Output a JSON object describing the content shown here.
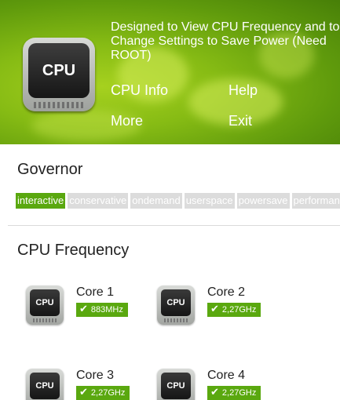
{
  "header": {
    "app_icon_text": "CPU",
    "description": "Designed to View CPU Frequency and to Change Settings to Save Power (Need ROOT)",
    "menu": {
      "cpu_info": "CPU Info",
      "help": "Help",
      "more": "More",
      "exit": "Exit"
    }
  },
  "governor": {
    "title": "Governor",
    "options": [
      "interactive",
      "conservative",
      "ondemand",
      "userspace",
      "powersave",
      "performance"
    ],
    "selected": "interactive"
  },
  "frequency": {
    "title": "CPU Frequency",
    "cores": [
      {
        "icon_text": "CPU",
        "label": "Core 1",
        "value": "883MHz"
      },
      {
        "icon_text": "CPU",
        "label": "Core 2",
        "value": "2,27GHz"
      },
      {
        "icon_text": "CPU",
        "label": "Core 3",
        "value": "2,27GHz"
      },
      {
        "icon_text": "CPU",
        "label": "Core 4",
        "value": "2,27GHz"
      }
    ]
  },
  "icons": {
    "app_icon": "cpu-chip-icon",
    "core_icon": "cpu-chip-icon",
    "check": "check-icon"
  },
  "colors": {
    "accent_green": "#5aa80f",
    "banner_green": "#86bb14",
    "inactive_chip": "#dcdcdc"
  }
}
